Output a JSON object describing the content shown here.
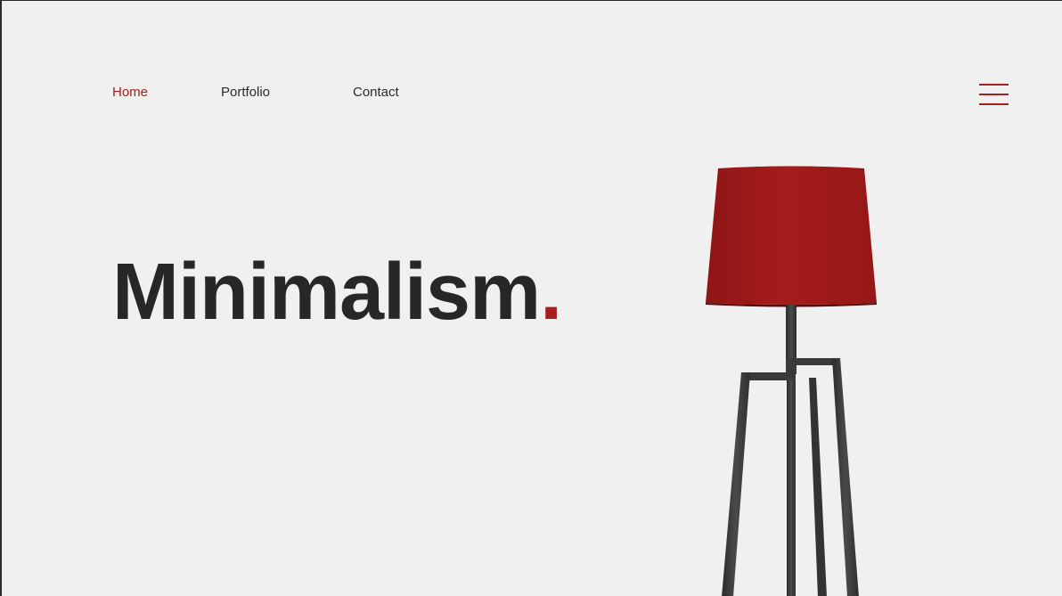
{
  "nav": {
    "items": [
      {
        "label": "Home",
        "active": true
      },
      {
        "label": "Portfolio",
        "active": false
      },
      {
        "label": "Contact",
        "active": false
      }
    ]
  },
  "menu": {
    "icon": "hamburger-menu-icon"
  },
  "hero": {
    "title": "Minimalism",
    "title_suffix": "."
  },
  "image": {
    "subject": "lamp-illustration"
  },
  "colors": {
    "accent": "#a51f1f",
    "background": "#f0f0f0",
    "text": "#272727"
  }
}
